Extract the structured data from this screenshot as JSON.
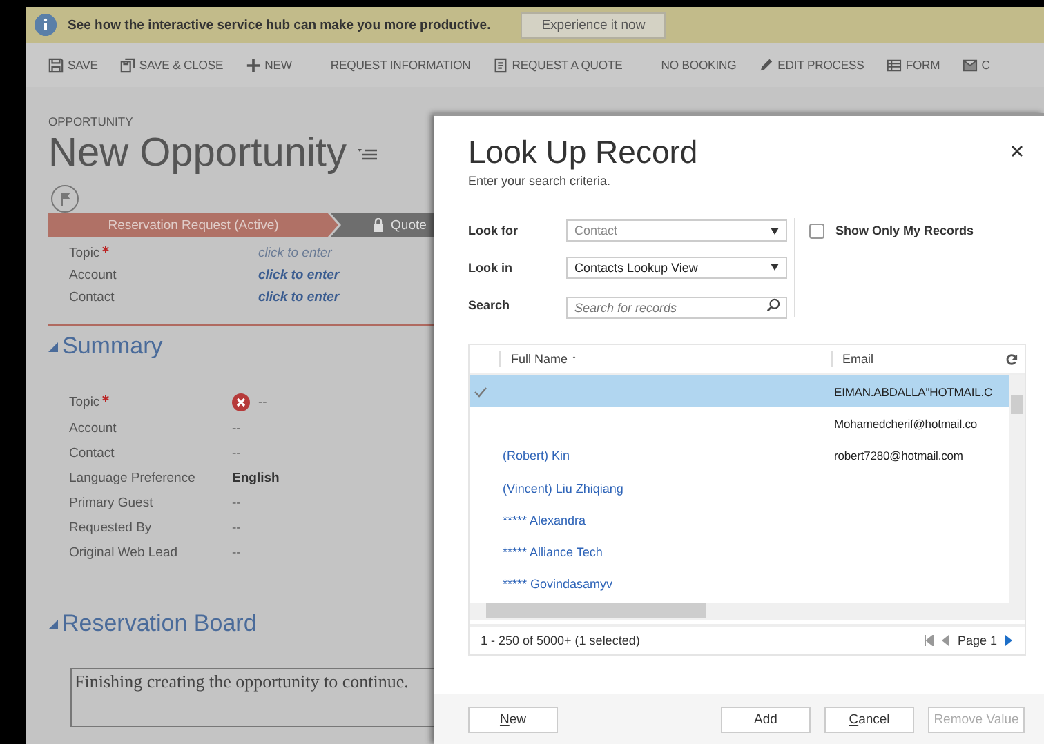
{
  "banner": {
    "message": "See how the interactive service hub can make you more productive.",
    "button": "Experience it now"
  },
  "toolbar": [
    {
      "label": "SAVE",
      "kind": "save"
    },
    {
      "label": "SAVE & CLOSE",
      "kind": "saveclose"
    },
    {
      "label": "NEW",
      "kind": "new"
    },
    {
      "label": "REQUEST INFORMATION",
      "kind": "plain"
    },
    {
      "label": "REQUEST A QUOTE",
      "kind": "quote"
    },
    {
      "label": "NO BOOKING",
      "kind": "plain"
    },
    {
      "label": "EDIT PROCESS",
      "kind": "edit"
    },
    {
      "label": "FORM",
      "kind": "form"
    },
    {
      "label": "C",
      "kind": "mail"
    }
  ],
  "record": {
    "entity": "OPPORTUNITY",
    "title": "New Opportunity"
  },
  "process": [
    {
      "label": "Reservation Request (Active)",
      "selected": true,
      "locked": false
    },
    {
      "label": "Quote",
      "selected": false,
      "locked": true
    }
  ],
  "header_fields": [
    {
      "label": "Topic",
      "required": true,
      "kind": "text",
      "value": "click to enter"
    },
    {
      "label": "Account",
      "required": false,
      "kind": "lookup",
      "value": "click to enter"
    },
    {
      "label": "Contact",
      "required": false,
      "kind": "lookup",
      "value": "click to enter"
    }
  ],
  "summary": {
    "title": "Summary",
    "expanded": true,
    "fields": [
      {
        "label": "Topic",
        "required": true,
        "error": true,
        "bold": false,
        "value": "--"
      },
      {
        "label": "Account",
        "required": false,
        "error": false,
        "bold": false,
        "value": "--"
      },
      {
        "label": "Contact",
        "required": false,
        "error": false,
        "bold": false,
        "value": "--"
      },
      {
        "label": "Language Preference",
        "required": false,
        "error": false,
        "bold": true,
        "value": "English"
      },
      {
        "label": "Primary Guest",
        "required": false,
        "error": false,
        "bold": false,
        "value": "--"
      },
      {
        "label": "Requested By",
        "required": false,
        "error": false,
        "bold": false,
        "value": "--"
      },
      {
        "label": "Original Web Lead",
        "required": false,
        "error": false,
        "bold": false,
        "value": "--"
      }
    ]
  },
  "reservation_board": {
    "title": "Reservation Board",
    "expanded": true,
    "message": "Finishing creating the opportunity to continue."
  },
  "dialog": {
    "title": "Look Up Record",
    "subtitle": "Enter your search criteria.",
    "look_for": {
      "label": "Look for",
      "value": "Contact",
      "disabled": true
    },
    "look_in": {
      "label": "Look in",
      "value": "Contacts Lookup View",
      "disabled": false
    },
    "search": {
      "label": "Search",
      "placeholder": "Search for records"
    },
    "show_only_mine": {
      "label": "Show Only My Records",
      "checked": false
    },
    "columns": [
      "Full Name",
      "Email"
    ],
    "sort_arrow": "↑",
    "rows": [
      {
        "email": "EIMAN.ABDALLA\"HOTMAIL.C",
        "selected": true
      },
      {
        "email": "Mohamedcherif@hotmail.co",
        "selected": false
      },
      {
        "name": "(Robert) Kin",
        "email": "robert7280@hotmail.com",
        "selected": false
      },
      {
        "name": "(Vincent) Liu Zhiqiang",
        "selected": false
      },
      {
        "name": "***** Alexandra",
        "selected": false
      },
      {
        "name": "***** Alliance Tech",
        "selected": false
      },
      {
        "name": "***** Govindasamyv",
        "selected": false
      }
    ],
    "status": "1 - 250 of 5000+ (1 selected)",
    "page": "Page 1",
    "buttons": [
      {
        "label": "New",
        "accesskey": true,
        "disabled": false
      },
      {
        "label": "Add",
        "accesskey": false,
        "disabled": false
      },
      {
        "label": "Cancel",
        "accesskey": true,
        "disabled": false
      },
      {
        "label": "Remove Value",
        "accesskey": false,
        "disabled": true
      }
    ]
  }
}
